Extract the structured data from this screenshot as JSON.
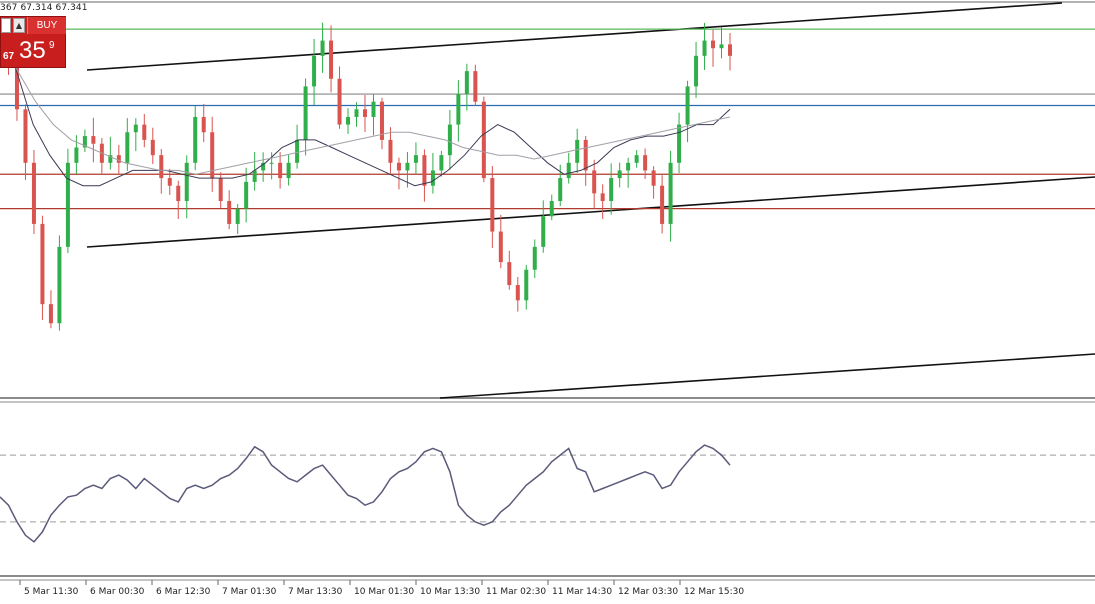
{
  "header": {
    "ohlc_text": "367 67.314 67.341"
  },
  "trade_panel": {
    "buy_label": "BUY",
    "price_prefix": "67",
    "price_main": "35",
    "price_pipette": "9",
    "color": "#c81e1e"
  },
  "chart_data": [
    {
      "type": "line",
      "panel": "main-price",
      "x_labels": [
        "5 Mar 11:30",
        "6 Mar 00:30",
        "6 Mar 12:30",
        "7 Mar 01:30",
        "7 Mar 13:30",
        "10 Mar 01:30",
        "10 Mar 13:30",
        "11 Mar 02:30",
        "11 Mar 14:30",
        "12 Mar 03:30",
        "12 Mar 15:30"
      ],
      "y_range": [
        0,
        100
      ],
      "close": [
        90,
        85,
        74,
        60,
        44,
        23,
        18,
        38,
        60,
        64,
        67,
        65,
        60,
        62,
        60,
        68,
        70,
        66,
        62,
        56,
        54,
        50,
        60,
        72,
        68,
        56,
        50,
        44,
        48,
        55,
        58,
        60,
        60,
        56,
        60,
        66,
        80,
        88,
        92,
        82,
        70,
        72,
        74,
        72,
        76,
        66,
        60,
        58,
        60,
        62,
        54,
        58,
        62,
        70,
        78,
        84,
        76,
        56,
        42,
        34,
        28,
        24,
        32,
        38,
        46,
        50,
        56,
        60,
        66,
        58,
        52,
        50,
        56,
        58,
        60,
        62,
        58,
        54,
        44,
        60,
        70,
        80,
        88,
        92,
        90,
        91,
        88
      ],
      "indicators": [
        {
          "name": "ma-fast",
          "color": "#3a3a55",
          "values": [
            98,
            84,
            70,
            62,
            56,
            54,
            54,
            56,
            58,
            58,
            58,
            57,
            56,
            56,
            56,
            57,
            60,
            64,
            66,
            66,
            64,
            62,
            60,
            58,
            56,
            54,
            55,
            58,
            62,
            67,
            70,
            68,
            64,
            60,
            57,
            58,
            60,
            64,
            66,
            67,
            67,
            68,
            70,
            70,
            74
          ]
        },
        {
          "name": "ma-slow",
          "color": "#a0a0a8",
          "values": [
            92,
            84,
            76,
            70,
            66,
            64,
            62,
            60,
            59,
            58,
            58,
            57,
            58,
            59,
            60,
            61,
            62,
            63,
            64,
            65,
            66,
            67,
            68,
            68,
            67,
            66,
            64,
            63,
            62,
            62,
            61,
            62,
            63,
            64,
            65,
            66,
            67,
            68,
            69,
            70,
            71,
            72
          ]
        }
      ],
      "horizontal_levels": [
        {
          "name": "green-line",
          "color": "#5cb85c",
          "value": 95
        },
        {
          "name": "gray-line",
          "color": "#888888",
          "value": 78
        },
        {
          "name": "blue-line",
          "color": "#2b6cb0",
          "value": 75
        },
        {
          "name": "red-line-upper",
          "color": "#b03a2e",
          "value": 57
        },
        {
          "name": "red-line-lower",
          "color": "#b03a2e",
          "value": 48
        }
      ]
    },
    {
      "type": "line",
      "panel": "oscillator",
      "y_range": [
        0,
        100
      ],
      "levels": [
        70,
        30
      ],
      "values": [
        45,
        40,
        30,
        22,
        18,
        24,
        34,
        40,
        45,
        46,
        50,
        52,
        50,
        56,
        58,
        55,
        50,
        56,
        52,
        48,
        44,
        42,
        50,
        52,
        50,
        52,
        56,
        58,
        62,
        68,
        75,
        72,
        64,
        60,
        56,
        54,
        58,
        62,
        64,
        58,
        52,
        46,
        44,
        40,
        42,
        48,
        56,
        60,
        62,
        66,
        72,
        74,
        72,
        60,
        40,
        34,
        30,
        28,
        30,
        36,
        40,
        46,
        52,
        56,
        60,
        66,
        70,
        74,
        62,
        60,
        48,
        50,
        52,
        54,
        56,
        58,
        60,
        58,
        50,
        52,
        60,
        66,
        72,
        76,
        74,
        70,
        64
      ]
    }
  ]
}
